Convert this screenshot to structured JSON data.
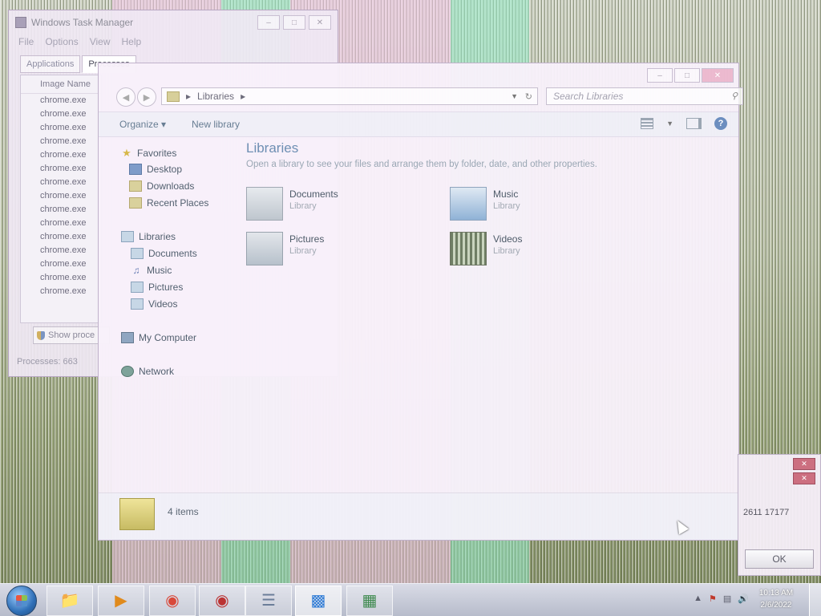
{
  "taskmgr": {
    "title": "Windows Task Manager",
    "menu": [
      "File",
      "Options",
      "View",
      "Help"
    ],
    "tabs": [
      "Applications",
      "Processes"
    ],
    "column_header": "Image Name",
    "rows": [
      "chrome.exe",
      "chrome.exe",
      "chrome.exe",
      "chrome.exe",
      "chrome.exe",
      "chrome.exe",
      "chrome.exe",
      "chrome.exe",
      "chrome.exe",
      "chrome.exe",
      "chrome.exe",
      "chrome.exe",
      "chrome.exe",
      "chrome.exe",
      "chrome.exe"
    ],
    "show_button": "Show proce",
    "status": "Processes: 663"
  },
  "explorer": {
    "address_root": "Libraries",
    "search_placeholder": "Search Libraries",
    "organize_label": "Organize ▾",
    "new_library_label": "New library",
    "nav": {
      "favorites": "Favorites",
      "desktop": "Desktop",
      "downloads": "Downloads",
      "recent": "Recent Places",
      "libraries": "Libraries",
      "documents": "Documents",
      "music": "Music",
      "pictures": "Pictures",
      "videos": "Videos",
      "computer": "My Computer",
      "network": "Network"
    },
    "title": "Libraries",
    "subtitle": "Open a library to see your files and arrange them by folder, date, and other properties.",
    "libraries": [
      {
        "name": "Documents",
        "type": "Library"
      },
      {
        "name": "Music",
        "type": "Library"
      },
      {
        "name": "Pictures",
        "type": "Library"
      },
      {
        "name": "Videos",
        "type": "Library"
      }
    ],
    "item_count": "4 items"
  },
  "dialog": {
    "text": "2611 17177",
    "ok_label": "OK"
  },
  "taskbar": {
    "clock_time": "10:13 AM",
    "clock_date": "2/6/2022"
  }
}
